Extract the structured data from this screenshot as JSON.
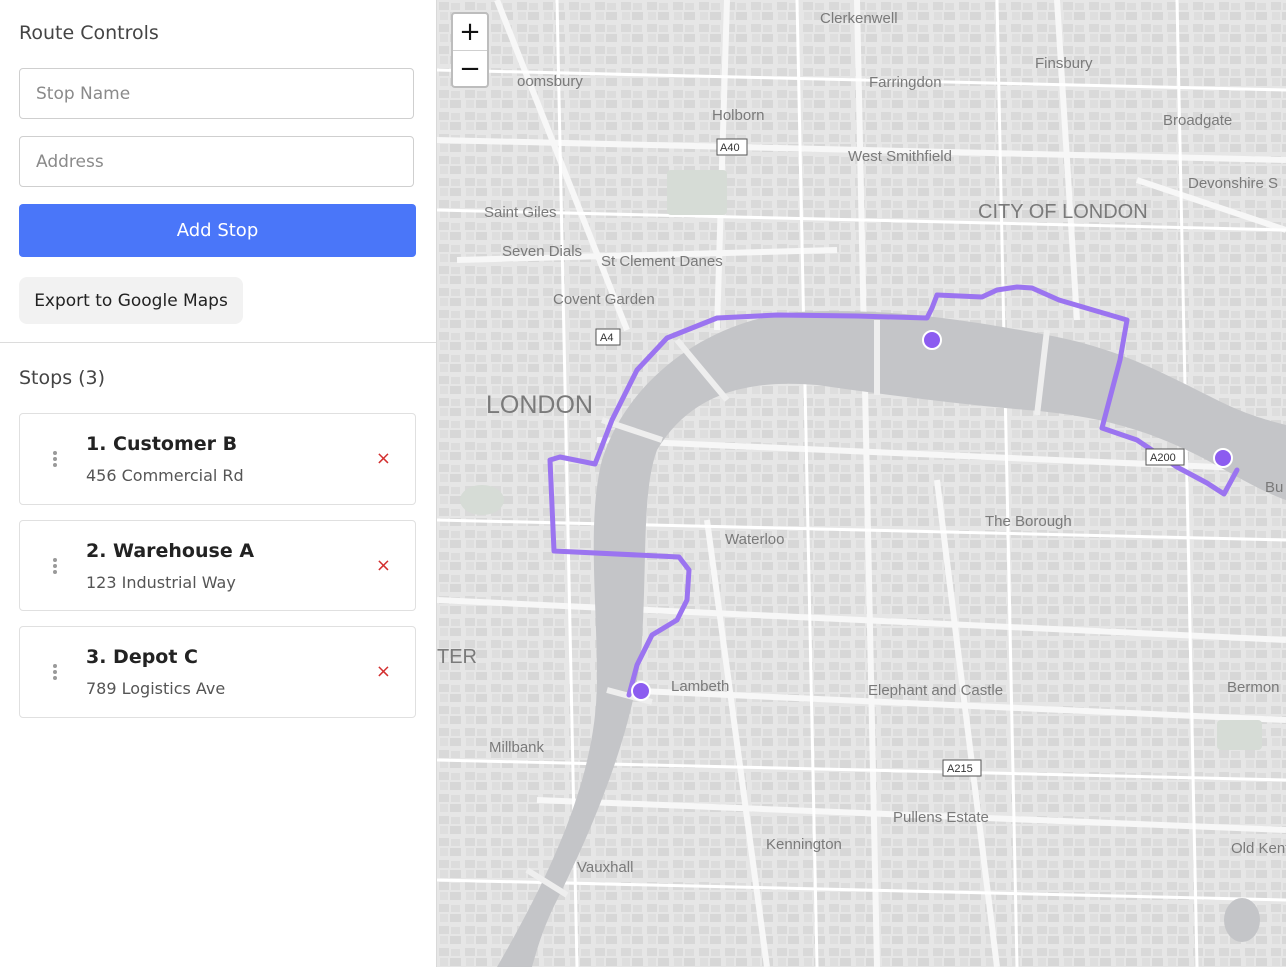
{
  "sidebar": {
    "title": "Route Controls",
    "stop_name_placeholder": "Stop Name",
    "address_placeholder": "Address",
    "add_button": "Add Stop",
    "export_button": "Export to Google Maps",
    "stops_heading": "Stops (3)",
    "stops": [
      {
        "name": "1. Customer B",
        "address": "456 Commercial Rd"
      },
      {
        "name": "2. Warehouse A",
        "address": "123 Industrial Way"
      },
      {
        "name": "3. Depot C",
        "address": "789 Logistics Ave"
      }
    ],
    "remove_icon": "×"
  },
  "map": {
    "zoom_in": "+",
    "zoom_out": "−",
    "route_color": "#9b74f0",
    "marker_color": "#8c5cf0",
    "water_color": "#c4c5c8",
    "labels": {
      "clerkenwell": "Clerkenwell",
      "finsbury": "Finsbury",
      "bloomsbury": "oomsbury",
      "farringdon": "Farringdon",
      "holborn": "Holborn",
      "broadgate": "Broadgate",
      "a40": "A40",
      "west_smithfield": "West Smithfield",
      "devonshire": "Devonshire S",
      "saint_giles": "Saint Giles",
      "city_of_london": "CITY OF LONDON",
      "seven_dials": "Seven Dials",
      "st_clement_danes": "St Clement Danes",
      "covent_garden": "Covent Garden",
      "a4": "A4",
      "london": "LONDON",
      "a200": "A200",
      "bu": "Bu",
      "the_borough": "The Borough",
      "waterloo": "Waterloo",
      "ter": "TER",
      "lambeth": "Lambeth",
      "elephant_castle": "Elephant and Castle",
      "bermon": "Bermon",
      "millbank": "Millbank",
      "a215": "A215",
      "pullens_estate": "Pullens Estate",
      "kennington": "Kennington",
      "old_kent": "Old Kent",
      "vauxhall": "Vauxhall"
    }
  }
}
